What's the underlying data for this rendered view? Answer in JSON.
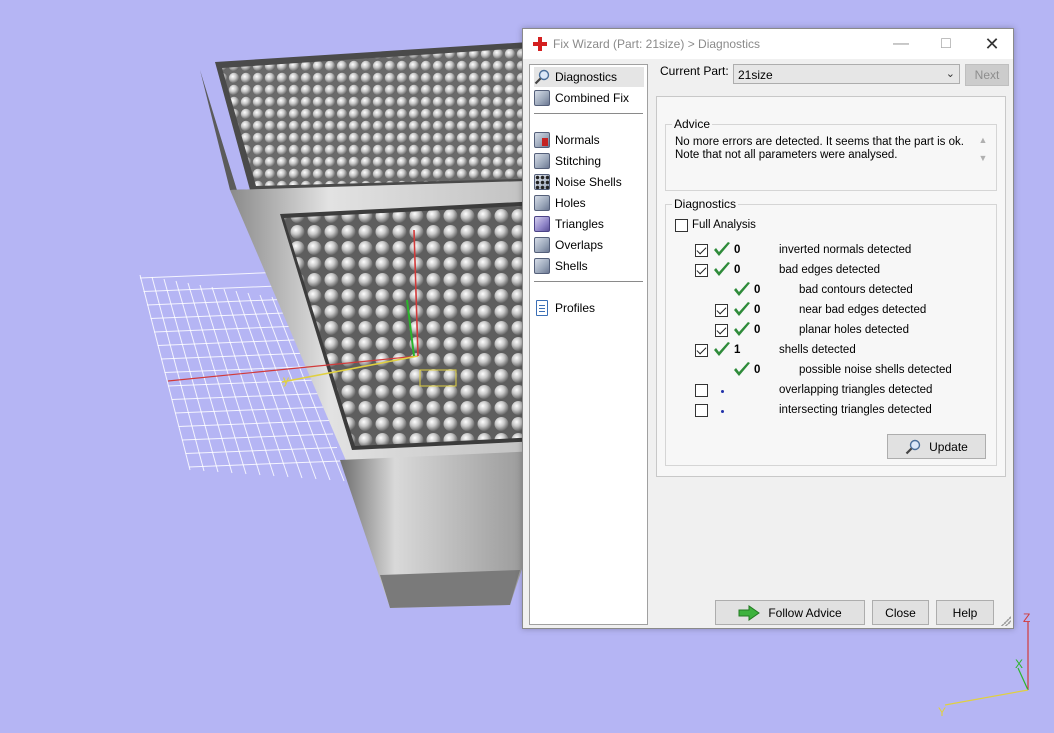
{
  "viewport": {
    "axis_labels": {
      "y": "y",
      "x": "x",
      "z": "Z"
    },
    "corner_axes": {
      "z": "Z",
      "x": "X",
      "y": "Y"
    }
  },
  "dialog": {
    "title": "Fix Wizard (Part: 21size) > Diagnostics",
    "nav": {
      "items": [
        {
          "label": "Diagnostics",
          "icon": "magnifier-icon",
          "selected": true
        },
        {
          "label": "Combined Fix",
          "icon": "cube-icon"
        },
        {
          "label": "Normals",
          "icon": "normals-cube-icon"
        },
        {
          "label": "Stitching",
          "icon": "stitching-cube-icon"
        },
        {
          "label": "Noise Shells",
          "icon": "noise-shells-icon"
        },
        {
          "label": "Holes",
          "icon": "holes-cube-icon"
        },
        {
          "label": "Triangles",
          "icon": "triangles-icon"
        },
        {
          "label": "Overlaps",
          "icon": "overlaps-cube-icon"
        },
        {
          "label": "Shells",
          "icon": "shells-cube-icon"
        },
        {
          "label": "Profiles",
          "icon": "document-icon"
        }
      ]
    },
    "current_part_label": "Current Part:",
    "current_part_value": "21size",
    "next_label": "Next",
    "advice": {
      "title": "Advice",
      "text": "No more errors are detected. It seems that the part is ok. Note that not all parameters were analysed."
    },
    "diagnostics": {
      "title": "Diagnostics",
      "full_analysis_label": "Full Analysis",
      "full_analysis_checked": false,
      "rows": [
        {
          "checkbox": true,
          "checked": true,
          "status": "ok",
          "count": "0",
          "label": "inverted normals detected",
          "indent": 0
        },
        {
          "checkbox": true,
          "checked": true,
          "status": "ok",
          "count": "0",
          "label": "bad edges detected",
          "indent": 0
        },
        {
          "checkbox": false,
          "checked": false,
          "status": "ok",
          "count": "0",
          "label": "bad contours detected",
          "indent": 1
        },
        {
          "checkbox": true,
          "checked": true,
          "status": "ok",
          "count": "0",
          "label": "near bad edges detected",
          "indent": 1
        },
        {
          "checkbox": true,
          "checked": true,
          "status": "ok",
          "count": "0",
          "label": "planar holes detected",
          "indent": 1
        },
        {
          "checkbox": true,
          "checked": true,
          "status": "ok",
          "count": "1",
          "label": "shells detected",
          "indent": 0
        },
        {
          "checkbox": false,
          "checked": false,
          "status": "ok",
          "count": "0",
          "label": "possible noise shells detected",
          "indent": 1
        },
        {
          "checkbox": true,
          "checked": false,
          "status": "pending",
          "count": "",
          "label": "overlapping triangles detected",
          "indent": 0
        },
        {
          "checkbox": true,
          "checked": false,
          "status": "pending",
          "count": "",
          "label": "intersecting triangles detected",
          "indent": 0
        }
      ],
      "update_label": "Update"
    },
    "footer": {
      "follow_advice_label": "Follow Advice",
      "close_label": "Close",
      "help_label": "Help"
    }
  },
  "colors": {
    "background": "#b5b5f4",
    "check_green": "#2e8b3a",
    "axis_red": "#d23a3a",
    "axis_yellow": "#e0d040",
    "axis_green": "#2bb52b"
  }
}
